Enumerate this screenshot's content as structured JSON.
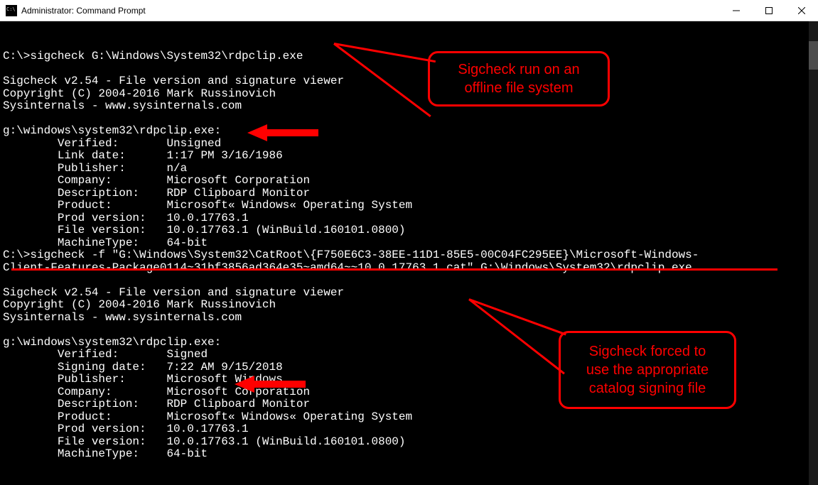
{
  "window": {
    "title": "Administrator: Command Prompt"
  },
  "annotations": {
    "callout1": "Sigcheck run on an\noffline file system",
    "callout2": "Sigcheck forced to\nuse the appropriate\ncatalog signing file"
  },
  "terminal": {
    "prompt": "C:\\>",
    "cmd1": "sigcheck G:\\Windows\\System32\\rdpclip.exe",
    "banner1": "Sigcheck v2.54 - File version and signature viewer",
    "banner2": "Copyright (C) 2004-2016 Mark Russinovich",
    "banner3": "Sysinternals - www.sysinternals.com",
    "file1_path": "g:\\windows\\system32\\rdpclip.exe:",
    "file1": {
      "l1": "        Verified:       Unsigned",
      "l2": "        Link date:      1:17 PM 3/16/1986",
      "l3": "        Publisher:      n/a",
      "l4": "        Company:        Microsoft Corporation",
      "l5": "        Description:    RDP Clipboard Monitor",
      "l6": "        Product:        Microsoft« Windows« Operating System",
      "l7": "        Prod version:   10.0.17763.1",
      "l8": "        File version:   10.0.17763.1 (WinBuild.160101.0800)",
      "l9": "        MachineType:    64-bit"
    },
    "cmd2a": "sigcheck -f \"G:\\Windows\\System32\\CatRoot\\{F750E6C3-38EE-11D1-85E5-00C04FC295EE}\\Microsoft-Windows-",
    "cmd2b": "Client-Features-Package0114~31bf3856ad364e35~amd64~~10.0.17763.1.cat\" G:\\Windows\\System32\\rdpclip.exe",
    "file2_path": "g:\\windows\\system32\\rdpclip.exe:",
    "file2": {
      "l1": "        Verified:       Signed",
      "l2": "        Signing date:   7:22 AM 9/15/2018",
      "l3": "        Publisher:      Microsoft Windows",
      "l4": "        Company:        Microsoft Corporation",
      "l5": "        Description:    RDP Clipboard Monitor",
      "l6": "        Product:        Microsoft« Windows« Operating System",
      "l7": "        Prod version:   10.0.17763.1",
      "l8": "        File version:   10.0.17763.1 (WinBuild.160101.0800)",
      "l9": "        MachineType:    64-bit"
    }
  }
}
